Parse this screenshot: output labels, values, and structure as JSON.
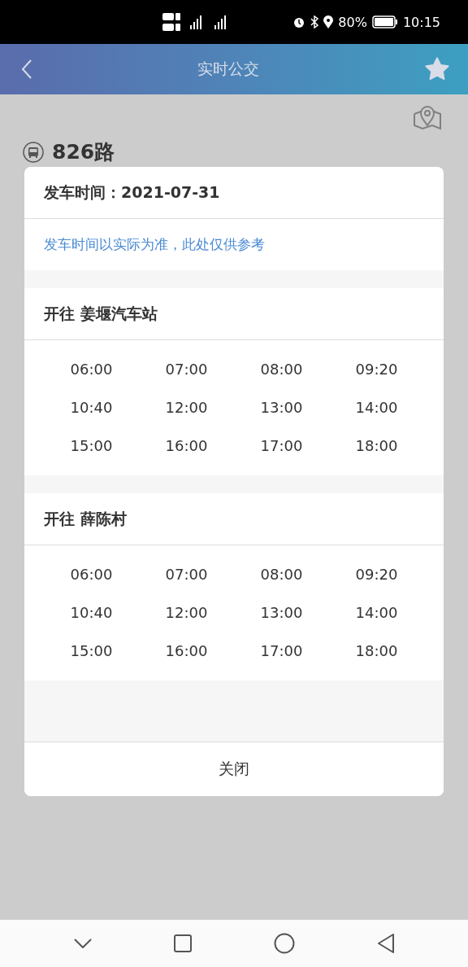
{
  "status_bar": {
    "battery": "80%",
    "time": "10:15"
  },
  "header": {
    "title": "实时公交"
  },
  "route": {
    "name": "826路"
  },
  "dialog": {
    "title": "发车时间：2021-07-31",
    "notice": "发车时间以实际为准，此处仅供参考",
    "directions": [
      {
        "title": "开往 姜堰汽车站",
        "times": [
          "06:00",
          "07:00",
          "08:00",
          "09:20",
          "10:40",
          "12:00",
          "13:00",
          "14:00",
          "15:00",
          "16:00",
          "17:00",
          "18:00"
        ]
      },
      {
        "title": "开往 薛陈村",
        "times": [
          "06:00",
          "07:00",
          "08:00",
          "09:20",
          "10:40",
          "12:00",
          "13:00",
          "14:00",
          "15:00",
          "16:00",
          "17:00",
          "18:00"
        ]
      }
    ],
    "close_button": "关闭"
  }
}
